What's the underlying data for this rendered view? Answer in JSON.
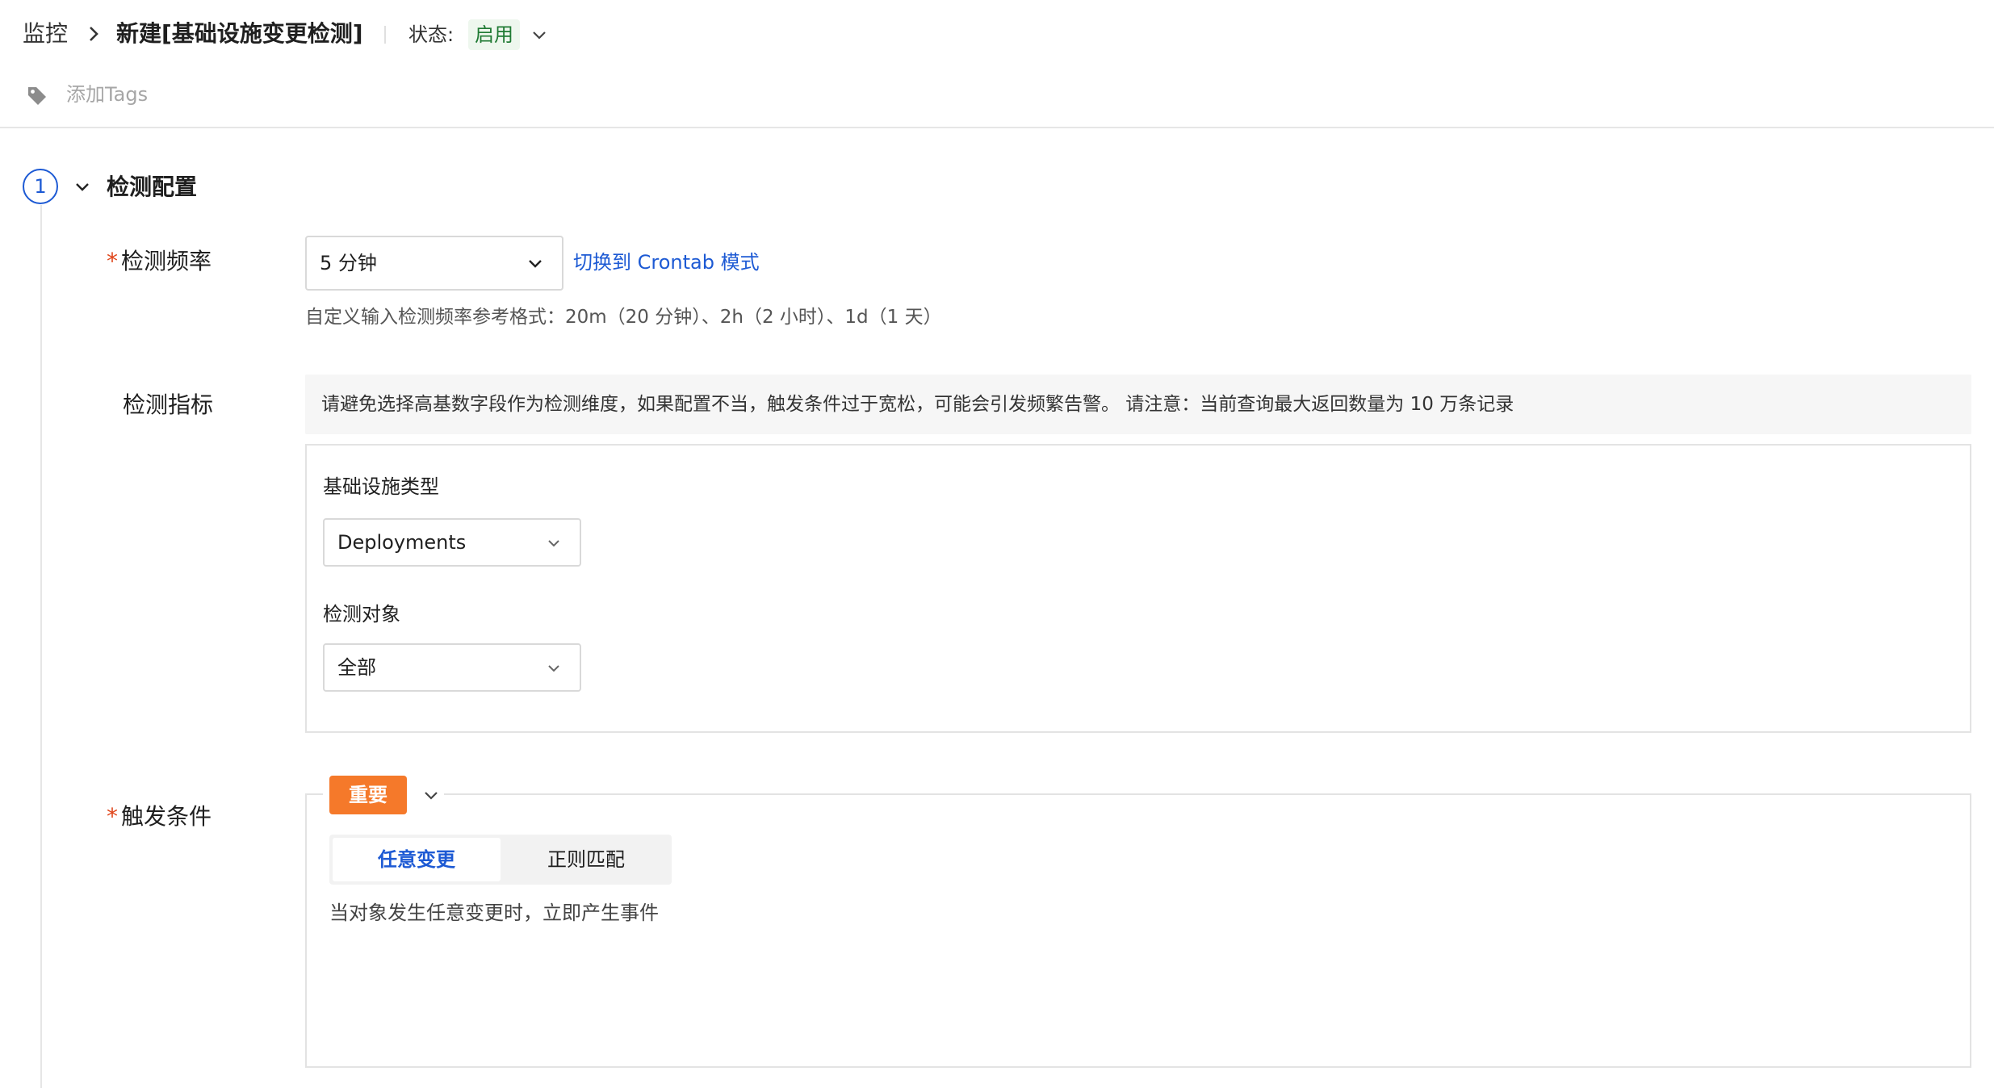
{
  "header": {
    "breadcrumb_root": "监控",
    "title": "新建[基础设施变更检测]",
    "status_label": "状态:",
    "status_value": "启用",
    "add_tags": "添加Tags"
  },
  "section": {
    "step_number": "1",
    "title": "检测配置"
  },
  "frequency": {
    "required_mark": "*",
    "label": "检测频率",
    "selected": "5 分钟",
    "crontab_link": "切换到 Crontab 模式",
    "help": "自定义输入检测频率参考格式：20m（20 分钟）、2h（2 小时）、1d（1 天）"
  },
  "metrics": {
    "label": "检测指标",
    "notice": "请避免选择高基数字段作为检测维度，如果配置不当，触发条件过于宽松，可能会引发频繁告警。 请注意：当前查询最大返回数量为 10 万条记录",
    "infra_type_label": "基础设施类型",
    "infra_type_value": "Deployments",
    "target_label": "检测对象",
    "target_value": "全部"
  },
  "trigger": {
    "required_mark": "*",
    "label": "触发条件",
    "severity": "重要",
    "tabs": [
      {
        "label": "任意变更"
      },
      {
        "label": "正则匹配"
      }
    ],
    "description": "当对象发生任意变更时，立即产生事件"
  },
  "colors": {
    "primary": "#1d5ad4",
    "severity": "#f5792a",
    "required": "#e0461b",
    "status_text": "#1f7a33"
  }
}
